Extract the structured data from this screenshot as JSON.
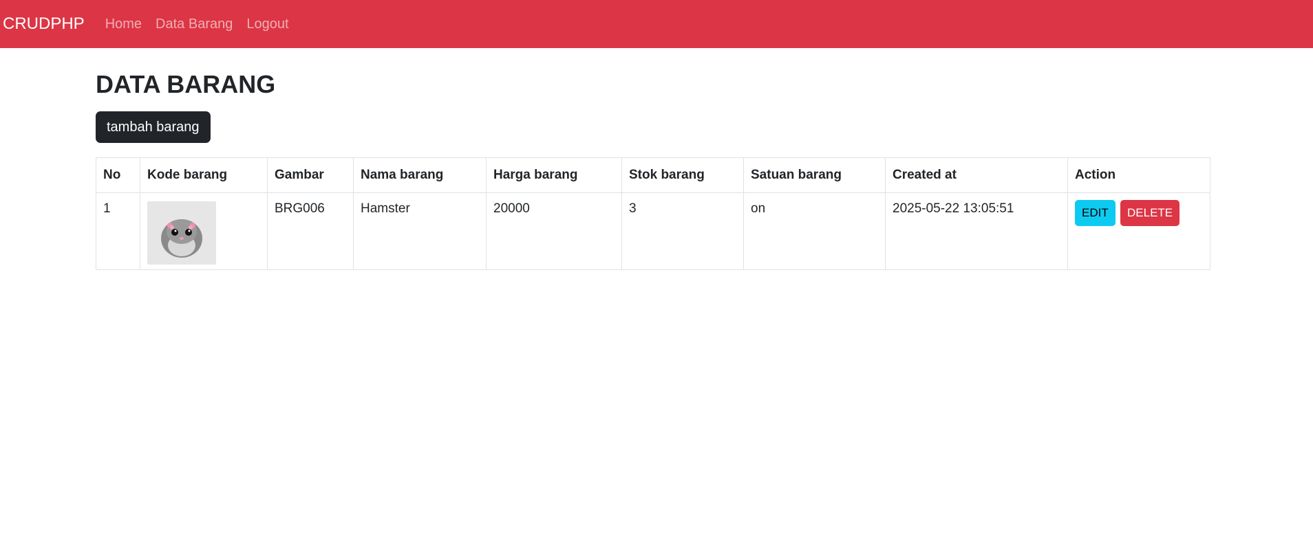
{
  "navbar": {
    "brand": "CRUDPHP",
    "links": [
      "Home",
      "Data Barang",
      "Logout"
    ]
  },
  "page": {
    "title": "DATA BARANG",
    "add_button": "tambah barang"
  },
  "table": {
    "headers": [
      "No",
      "Kode barang",
      "Gambar",
      "Nama barang",
      "Harga barang",
      "Stok barang",
      "Satuan barang",
      "Created at",
      "Action"
    ],
    "rows": [
      {
        "no": "1",
        "image_icon": "hamster-photo",
        "kode": "BRG006",
        "nama": "Hamster",
        "harga": "20000",
        "stok": "3",
        "satuan": "on",
        "created_at": "2025-05-22 13:05:51",
        "edit_label": "EDIT",
        "delete_label": "DELETE"
      }
    ]
  },
  "colors": {
    "navbar": "#dc3545",
    "add_button": "#212529",
    "edit_button": "#0dcaf0",
    "delete_button": "#dc3545"
  }
}
